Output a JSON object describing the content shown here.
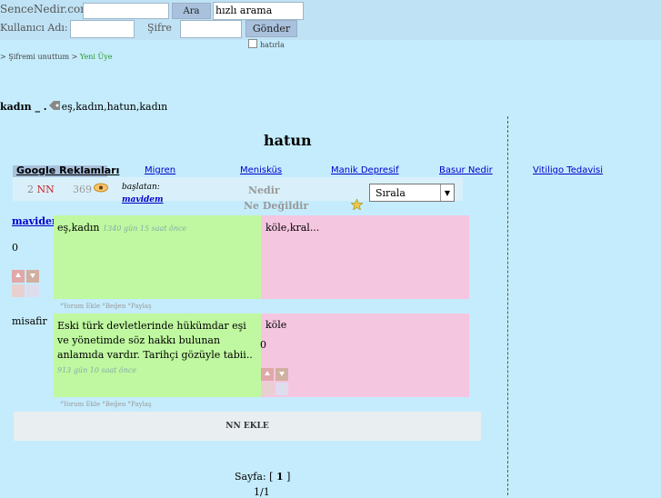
{
  "header": {
    "site_name": "SenceNedir.com",
    "search_button": "Ara",
    "quick_search_value": "hızlı arama",
    "username_label": "Kullanıcı Adı:",
    "password_label": "Şifre",
    "submit_button": "Gönder",
    "remember_label": "hatırla"
  },
  "nav": {
    "forgot_password": "> Şifremi unuttum",
    "new_member_sep": ">",
    "new_member": "Yeni Üye"
  },
  "tags_line": {
    "prefix": "kadın _ .",
    "tags": "eş,kadın,hatun,kadın"
  },
  "topic": {
    "title": "hatun"
  },
  "ads": {
    "heading": "Google Reklamları",
    "links": [
      "Migren",
      "Menisküs",
      "Manik Depresif",
      "Basur Nedir",
      "Vitiligo Tedavisi"
    ]
  },
  "stats": {
    "count_a": "2",
    "count_a_label": "NN",
    "count_b": "369",
    "started_by_label": "başlatan:",
    "started_by_user": "mavidem",
    "tab_nedir": "Nedir",
    "tab_ne_degildir": "Ne Değildir",
    "sort_label": "Sırala"
  },
  "entries": [
    {
      "author": "mavidem",
      "score": "0",
      "left_text": "eş,kadın",
      "left_meta": "1340 gün 15 saat önce",
      "right_text": "köle,kral...",
      "right_score": "",
      "actions": "°Yorum Ekle °Beğen °Paylaş"
    },
    {
      "author": "misafir",
      "score": "",
      "left_text": "Eski türk devletlerinde hükümdar eşi ve yönetimde söz hakkı bulunan anlamıda vardır. Tarihçi gözüyle tabii..",
      "left_meta": "913 gün 10 saat önce",
      "right_text": "köle",
      "right_score": "0",
      "actions": "°Yorum Ekle °Beğen °Paylaş"
    }
  ],
  "add_entry": "NN EKLE",
  "pagination": {
    "label": "Sayfa: [",
    "current": "1",
    "close": "]",
    "summary": "1/1"
  },
  "colors": {
    "background": "#c5ecfc",
    "nedir_box": "#bff8a0",
    "ne_degildir_box": "#f5c6e0"
  }
}
